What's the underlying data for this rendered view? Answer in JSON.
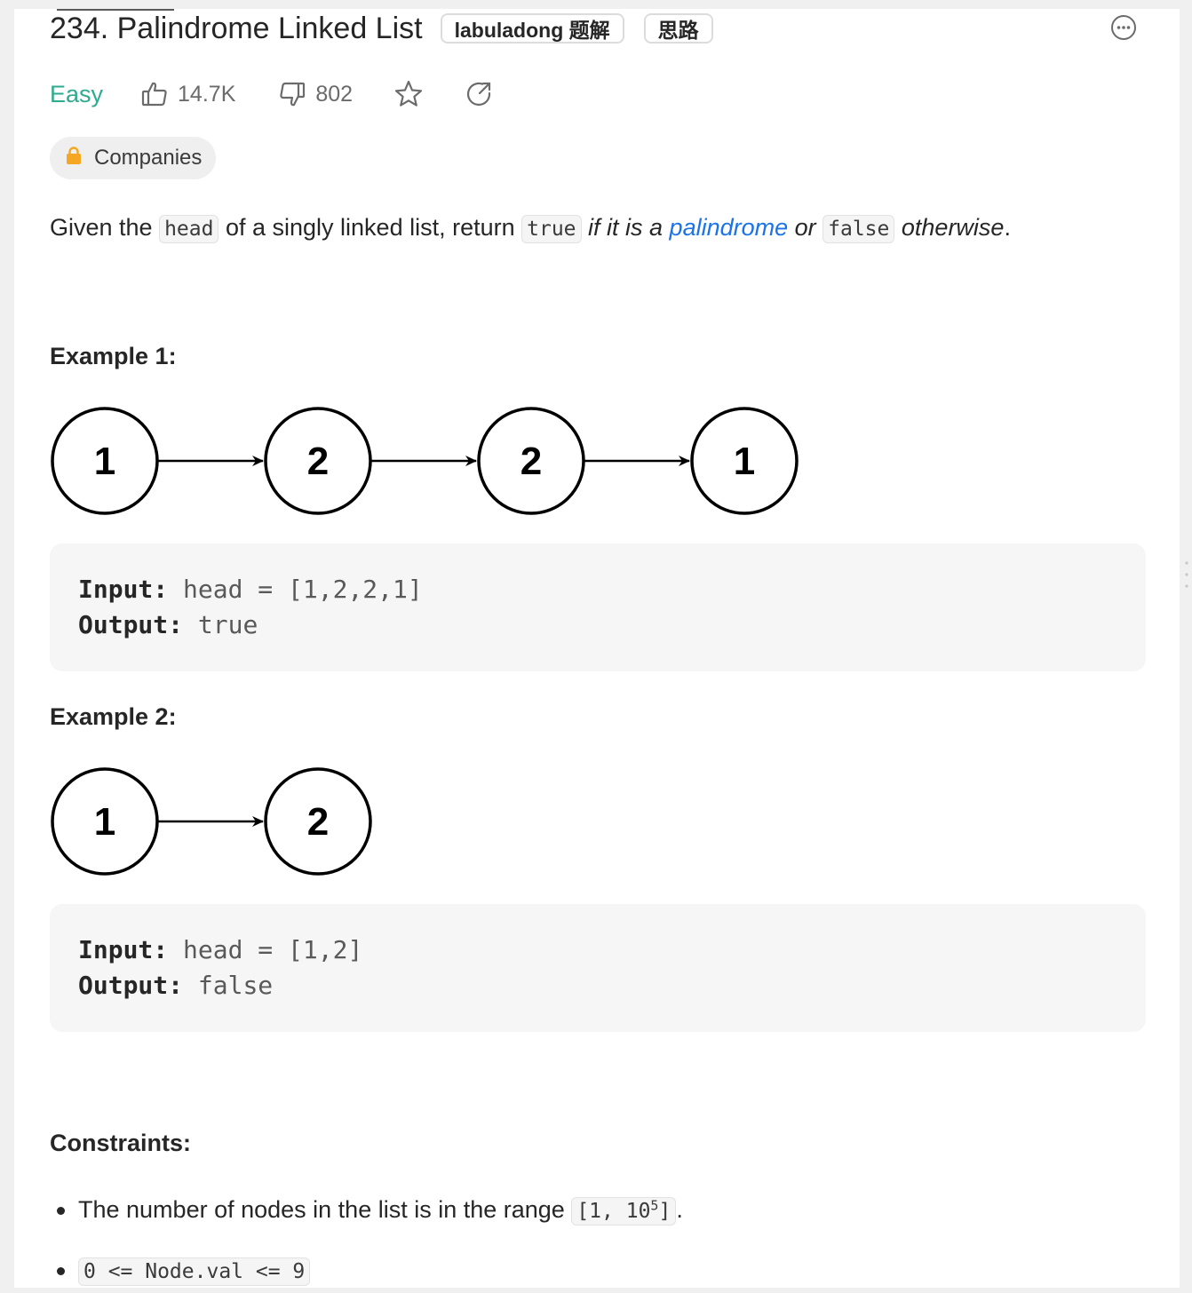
{
  "problem": {
    "title": "234. Palindrome Linked List",
    "chips": [
      "labuladong 题解",
      "思路"
    ],
    "difficulty": "Easy",
    "likes": "14.7K",
    "dislikes": "802",
    "companies_label": "Companies"
  },
  "description": {
    "p1": "Given the ",
    "code_head": "head",
    "p2": " of a singly linked list, return ",
    "code_true": "true",
    "p3": " if it is a ",
    "link": "palindrome",
    "p4": " or ",
    "code_false": "false",
    "p5": " otherwise",
    "p6": "."
  },
  "examples": [
    {
      "heading": "Example 1:",
      "nodes": [
        "1",
        "2",
        "2",
        "1"
      ],
      "input_label": "Input:",
      "input_value": " head = [1,2,2,1]",
      "output_label": "Output:",
      "output_value": " true"
    },
    {
      "heading": "Example 2:",
      "nodes": [
        "1",
        "2"
      ],
      "input_label": "Input:",
      "input_value": " head = [1,2]",
      "output_label": "Output:",
      "output_value": " false"
    }
  ],
  "constraints": {
    "heading": "Constraints:",
    "c1_text": "The number of nodes in the list is in the range ",
    "c1_code_pre": "[1, 10",
    "c1_code_sup": "5",
    "c1_code_post": "]",
    "c1_end": ".",
    "c2_code": "0 <= Node.val <= 9"
  },
  "icons": [
    "thumbs-up-icon",
    "thumbs-down-icon",
    "star-icon",
    "share-icon",
    "lock-icon",
    "more-icon"
  ],
  "colors": {
    "easy": "#2eab8e",
    "link": "#1a73e8",
    "lock": "#f5a623"
  }
}
